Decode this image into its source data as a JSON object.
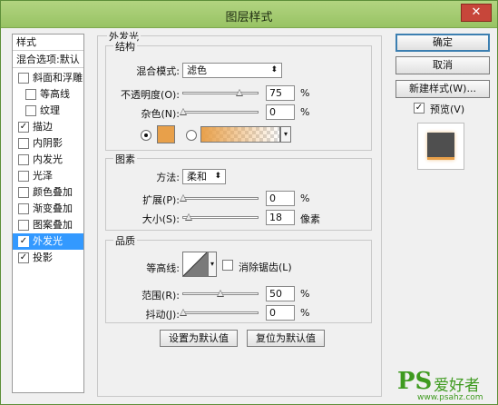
{
  "window": {
    "title": "图层样式",
    "close": "✕"
  },
  "left_list": {
    "header_styles": "样式",
    "blend_options": "混合选项:默认",
    "items": [
      {
        "label": "斜面和浮雕",
        "checked": false
      },
      {
        "label": "等高线",
        "checked": false
      },
      {
        "label": "纹理",
        "checked": false
      },
      {
        "label": "描边",
        "checked": true
      },
      {
        "label": "内阴影",
        "checked": false
      },
      {
        "label": "内发光",
        "checked": false
      },
      {
        "label": "光泽",
        "checked": false
      },
      {
        "label": "颜色叠加",
        "checked": false
      },
      {
        "label": "渐变叠加",
        "checked": false
      },
      {
        "label": "图案叠加",
        "checked": false
      },
      {
        "label": "外发光",
        "checked": true
      },
      {
        "label": "投影",
        "checked": true
      }
    ]
  },
  "panel": {
    "title": "外发光",
    "structure": {
      "title": "结构",
      "blend_mode_label": "混合模式:",
      "blend_mode_value": "滤色",
      "opacity_label": "不透明度(O):",
      "opacity_value": "75",
      "opacity_level": 0.75,
      "noise_label": "杂色(N):",
      "noise_value": "0",
      "noise_level": 0,
      "percent": "%",
      "swatch_color": "#e8a04a"
    },
    "elements": {
      "title": "图素",
      "technique_label": "方法:",
      "technique_value": "柔和",
      "spread_label": "扩展(P):",
      "spread_value": "0",
      "spread_level": 0,
      "size_label": "大小(S):",
      "size_value": "18",
      "size_unit": "像素",
      "size_level": 0.07,
      "percent": "%"
    },
    "quality": {
      "title": "品质",
      "contour_label": "等高线:",
      "anti_alias_label": "消除锯齿(L)",
      "range_label": "范围(R):",
      "range_value": "50",
      "range_level": 0.5,
      "jitter_label": "抖动(J):",
      "jitter_value": "0",
      "jitter_level": 0,
      "percent": "%"
    },
    "make_default": "设置为默认值",
    "reset_default": "复位为默认值"
  },
  "right": {
    "ok": "确定",
    "cancel": "取消",
    "new_style": "新建样式(W)...",
    "preview_label": "预览(V)",
    "preview_checked": true
  },
  "watermark": {
    "brand": "PS",
    "cn": "爱好者",
    "url": "www.psahz.com"
  }
}
